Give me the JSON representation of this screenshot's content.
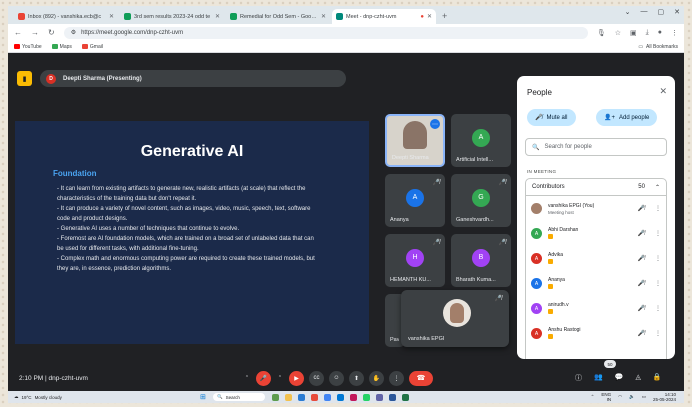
{
  "browser": {
    "tabs": [
      {
        "label": "Inbox (892) - vanshika.ecb@c",
        "color": "#ea4335",
        "active": false
      },
      {
        "label": "3rd sem results 2023-24 odd te",
        "color": "#0f9d58",
        "active": false
      },
      {
        "label": "Remedial for Odd Sem - Google",
        "color": "#0f9d58",
        "active": false
      },
      {
        "label": "Meet - dnp-czht-uvm",
        "color": "#00897b",
        "active": true
      }
    ],
    "url": "https://meet.google.com/dnp-czht-uvm",
    "bookmarks": [
      "YouTube",
      "Maps",
      "Gmail"
    ],
    "all_bookmarks": "All Bookmarks"
  },
  "meet": {
    "presenter_initial": "D",
    "presenting_label": "Deepti Sharma (Presenting)",
    "meeting_code": "dnp-czht-uvm",
    "time": "2:10 PM"
  },
  "slide": {
    "title": "Generative AI",
    "subtitle": "Foundation",
    "bullets": [
      "- It can learn from existing artifacts to generate new, realistic artifacts (at scale) that reflect the",
      "  characteristics of the training data but don't repeat it.",
      "- It can produce a variety of novel content, such as images, video, music, speech, text, software",
      "  code and product designs.",
      "- Generative AI uses a number of techniques that continue to evolve.",
      "- Foremost are AI foundation models, which are trained on a broad set of unlabeled data that can",
      "  be used for different tasks, with additional fine-tuning.",
      "- Complex math and enormous computing power are required to create these trained models, but",
      "  they are, in essence, prediction algorithms."
    ]
  },
  "tiles": [
    {
      "name": "Deepti Sharma",
      "initial": "",
      "color": "#8a7467"
    },
    {
      "name": "Artificial Intell...",
      "initial": "A",
      "color": "#34a853"
    },
    {
      "name": "Ananya",
      "initial": "A",
      "color": "#1a73e8"
    },
    {
      "name": "Ganeshvardh...",
      "initial": "G",
      "color": "#34a853"
    },
    {
      "name": "HEMANTH KU...",
      "initial": "H",
      "color": "#a142f4"
    },
    {
      "name": "Bharath Kuma...",
      "initial": "B",
      "color": "#a142f4"
    }
  ],
  "self_tile": {
    "name": "vanshika EPGI"
  },
  "partial_tile_name": "Pav",
  "people": {
    "title": "People",
    "mute_all": "Mute all",
    "add_people": "Add people",
    "search_placeholder": "Search for people",
    "in_meeting": "IN MEETING",
    "contributors_label": "Contributors",
    "contributors_count": "50",
    "list": [
      {
        "name": "vanshika EPGI (You)",
        "sub": "Meeting host",
        "initial": "",
        "color": "#a37f6a"
      },
      {
        "name": "Abhi Darshan",
        "sub": "",
        "initial": "A",
        "color": "#34a853"
      },
      {
        "name": "Advika",
        "sub": "",
        "initial": "A",
        "color": "#d93025"
      },
      {
        "name": "Ananya",
        "sub": "",
        "initial": "A",
        "color": "#1a73e8"
      },
      {
        "name": "anirudh.v",
        "sub": "",
        "initial": "A",
        "color": "#a142f4"
      },
      {
        "name": "Anshu Rastogi",
        "sub": "",
        "initial": "A",
        "color": "#d93025"
      }
    ]
  },
  "people_badge": "50",
  "taskbar": {
    "weather_temp": "19°C",
    "weather_desc": "Mostly cloudy",
    "search": "Search",
    "lang": "ENG",
    "lang2": "IN",
    "time": "14:10",
    "date": "25-05-2024"
  }
}
